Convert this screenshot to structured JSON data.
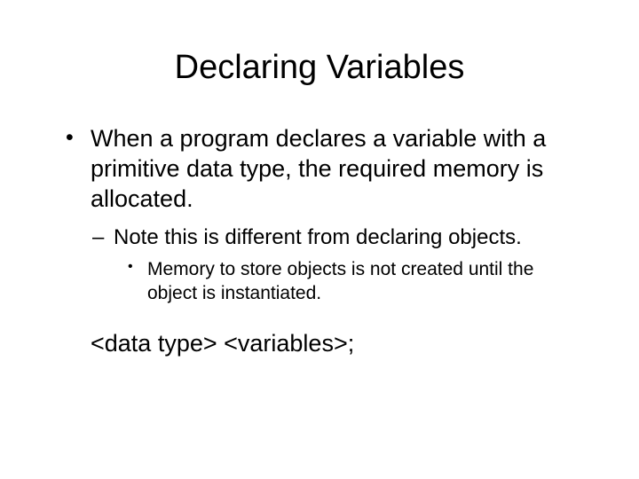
{
  "slide": {
    "title": "Declaring Variables",
    "bullet1": "When a program declares a variable with a primitive data type, the required memory is allocated.",
    "bullet2": "Note this is different from declaring objects.",
    "bullet3": "Memory to store objects is not created until the object is instantiated.",
    "syntax": "<data type> <variables>;"
  }
}
